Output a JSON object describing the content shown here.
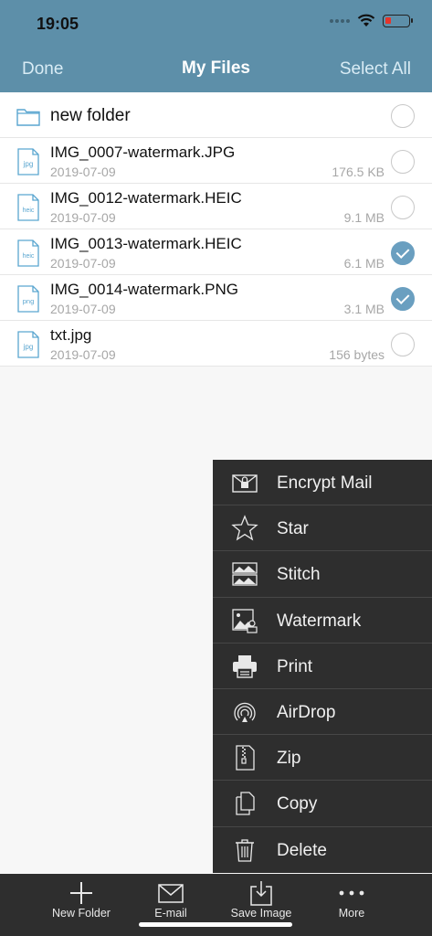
{
  "status_bar": {
    "time": "19:05"
  },
  "nav": {
    "left": "Done",
    "title": "My Files",
    "right": "Select All"
  },
  "files": [
    {
      "type": "folder",
      "name": "new folder",
      "checked": false
    },
    {
      "type": "jpg",
      "name": "IMG_0007-watermark.JPG",
      "date": "2019-07-09",
      "size": "176.5 KB",
      "checked": false
    },
    {
      "type": "heic",
      "name": "IMG_0012-watermark.HEIC",
      "date": "2019-07-09",
      "size": "9.1 MB",
      "checked": false
    },
    {
      "type": "heic",
      "name": "IMG_0013-watermark.HEIC",
      "date": "2019-07-09",
      "size": "6.1 MB",
      "checked": true
    },
    {
      "type": "png",
      "name": "IMG_0014-watermark.PNG",
      "date": "2019-07-09",
      "size": "3.1 MB",
      "checked": true
    },
    {
      "type": "jpg",
      "name": "txt.jpg",
      "date": "2019-07-09",
      "size": "156 bytes",
      "checked": false
    }
  ],
  "file_icons": {
    "jpg": "jpg",
    "heic": "heic",
    "png": "png"
  },
  "menu": [
    {
      "label": "Encrypt Mail",
      "icon": "encrypt-mail-icon"
    },
    {
      "label": "Star",
      "icon": "star-icon"
    },
    {
      "label": "Stitch",
      "icon": "stitch-icon"
    },
    {
      "label": "Watermark",
      "icon": "watermark-icon"
    },
    {
      "label": "Print",
      "icon": "print-icon"
    },
    {
      "label": "AirDrop",
      "icon": "airdrop-icon"
    },
    {
      "label": "Zip",
      "icon": "zip-icon"
    },
    {
      "label": "Copy",
      "icon": "copy-icon"
    },
    {
      "label": "Delete",
      "icon": "trash-icon"
    }
  ],
  "tabs": [
    {
      "label": "New Folder",
      "icon": "plus-icon"
    },
    {
      "label": "E-mail",
      "icon": "mail-icon"
    },
    {
      "label": "Save Image",
      "icon": "save-image-icon"
    },
    {
      "label": "More",
      "icon": "more-icon"
    }
  ],
  "colors": {
    "header": "#5d8fa9",
    "accent": "#6a9fc0",
    "menu_bg": "#2e2e2e"
  }
}
